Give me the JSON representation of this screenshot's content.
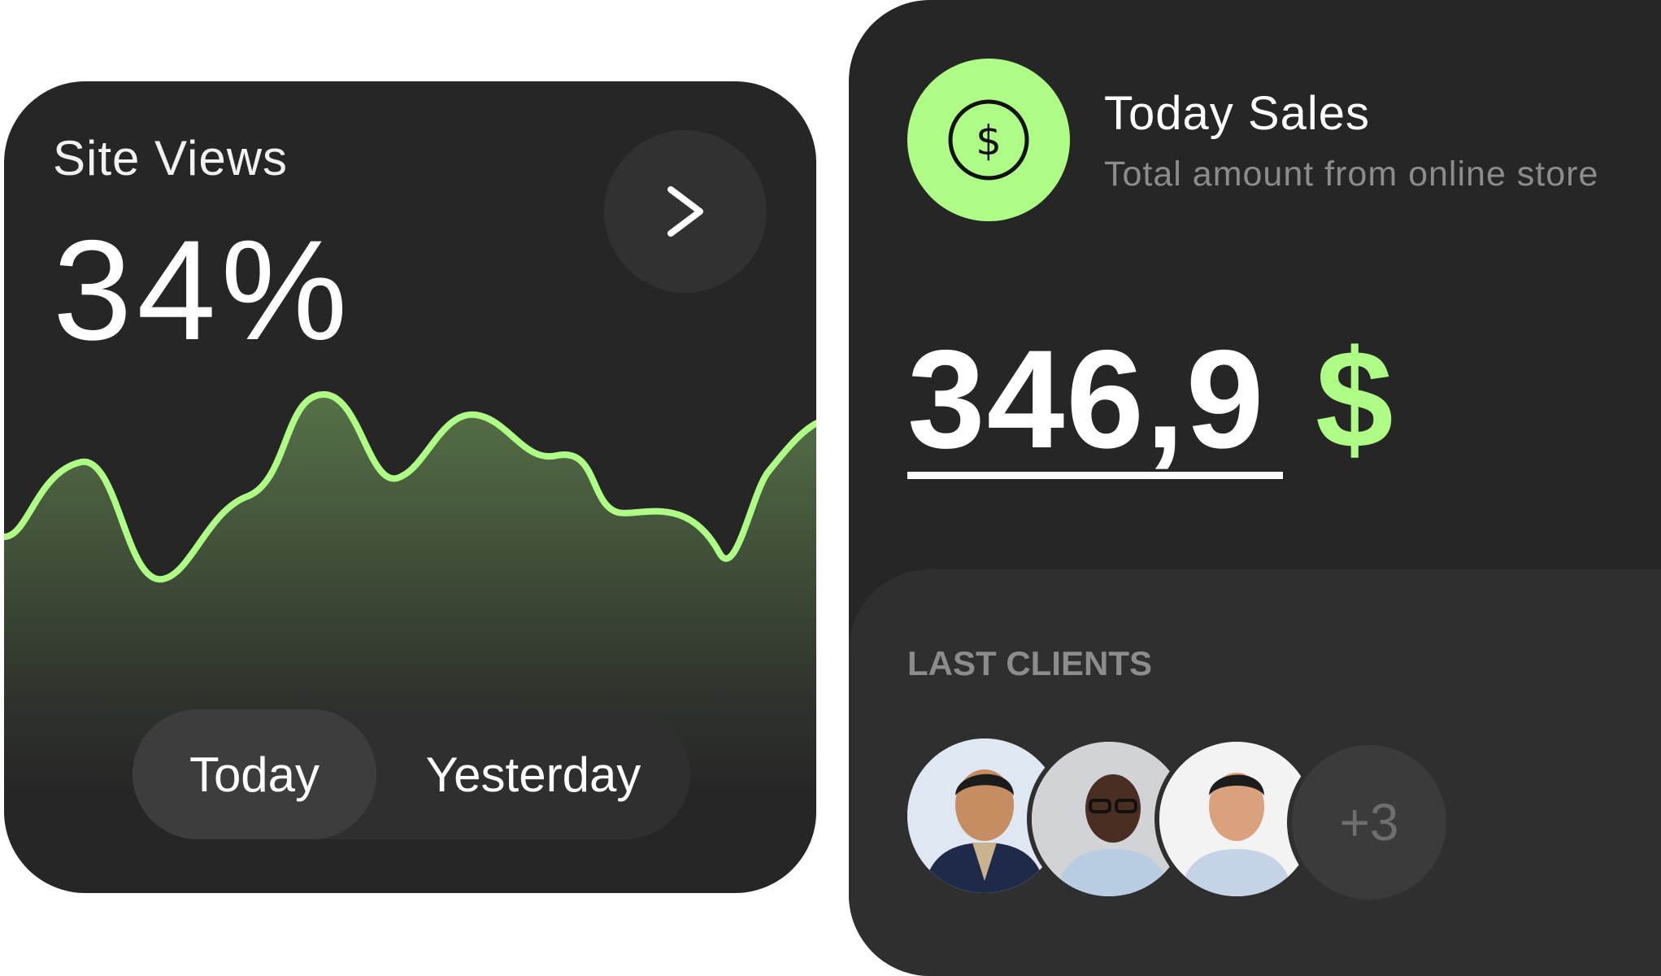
{
  "site_views": {
    "title": "Site Views",
    "value": "34%",
    "toggle": {
      "active": "Today",
      "inactive": "Yesterday"
    }
  },
  "sales": {
    "title": "Today Sales",
    "subtitle": "Total amount from online store",
    "amount": "346,9",
    "currency": "$",
    "icon_glyph": "$"
  },
  "clients": {
    "label": "LAST CLIENTS",
    "more": "+3",
    "avatar_icons": [
      "person-avatar-1",
      "person-avatar-2",
      "person-avatar-3"
    ]
  },
  "colors": {
    "card": "#262626",
    "panel": "#2f2f2f",
    "accent": "#aefc85",
    "muted": "#8c8c8c"
  }
}
